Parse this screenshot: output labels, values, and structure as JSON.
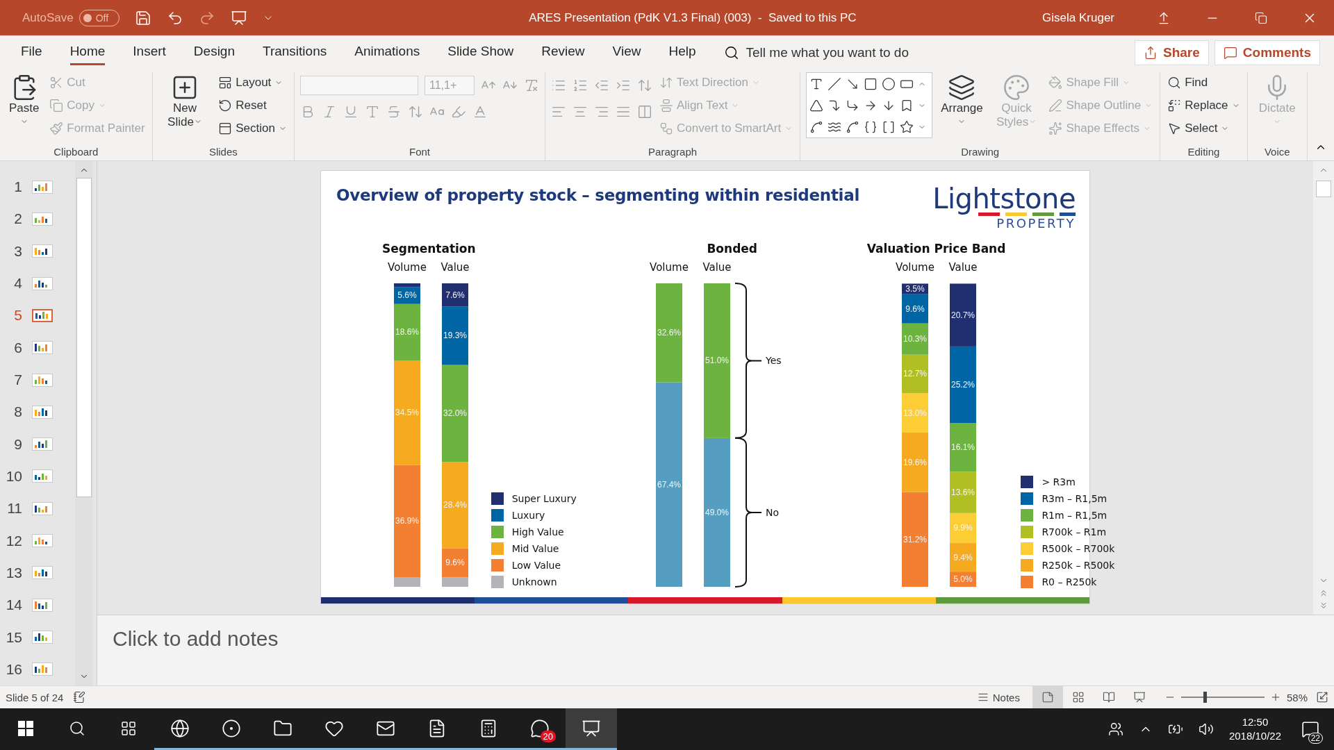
{
  "title_bar": {
    "autosave_label": "AutoSave",
    "autosave": {
      "on": false,
      "label": "Off"
    },
    "title": "ARES Presentation (PdK V1.3 Final) (003)  -  Saved to this PC",
    "user": "Gisela Kruger"
  },
  "tabs": [
    {
      "label": "File",
      "selected": false
    },
    {
      "label": "Home",
      "selected": true
    },
    {
      "label": "Insert",
      "selected": false
    },
    {
      "label": "Design",
      "selected": false
    },
    {
      "label": "Transitions",
      "selected": false
    },
    {
      "label": "Animations",
      "selected": false
    },
    {
      "label": "Slide Show",
      "selected": false
    },
    {
      "label": "Review",
      "selected": false
    },
    {
      "label": "View",
      "selected": false
    },
    {
      "label": "Help",
      "selected": false
    }
  ],
  "search": {
    "placeholder": "Tell me what you want to do"
  },
  "share_button": "Share",
  "comments_button": "Comments",
  "ribbon": {
    "groups": [
      {
        "label": "Clipboard",
        "kind": "plain",
        "items": [
          {
            "kind": "large",
            "label": "Paste",
            "disabled": false,
            "dropdown": true
          },
          {
            "kind": "small",
            "label": "Cut",
            "disabled": true,
            "dropdown": false
          },
          {
            "kind": "small",
            "label": "Copy",
            "disabled": true,
            "dropdown": true
          },
          {
            "kind": "small",
            "label": "Format Painter",
            "disabled": true,
            "dropdown": false
          }
        ]
      },
      {
        "label": "Slides",
        "kind": "plain",
        "items": [
          {
            "kind": "large",
            "label": "New Slide",
            "disabled": false,
            "dropdown": true
          },
          {
            "kind": "small",
            "label": "Layout",
            "disabled": false,
            "dropdown": true
          },
          {
            "kind": "small",
            "label": "Reset",
            "disabled": false,
            "dropdown": false
          },
          {
            "kind": "small",
            "label": "Section",
            "disabled": false,
            "dropdown": true
          }
        ]
      },
      {
        "label": "Font",
        "kind": "font",
        "items": [
          {
            "kind": "field",
            "disabled": true
          },
          {
            "kind": "field",
            "value": "11,1+",
            "disabled": true
          }
        ]
      },
      {
        "label": "Paragraph",
        "kind": "paragraph",
        "items": [
          {
            "kind": "small",
            "label": "Text Direction",
            "disabled": true,
            "dropdown": true
          },
          {
            "kind": "small",
            "label": "Align Text",
            "disabled": true,
            "dropdown": true
          },
          {
            "kind": "small",
            "label": "Convert to SmartArt",
            "disabled": true,
            "dropdown": true
          }
        ]
      },
      {
        "label": "Drawing",
        "kind": "plain",
        "items": [
          {
            "kind": "gallery"
          },
          {
            "kind": "large",
            "label": "Arrange",
            "disabled": false,
            "dropdown": true
          },
          {
            "kind": "large",
            "label": "Quick Styles",
            "disabled": true,
            "dropdown": true
          },
          {
            "kind": "small",
            "label": "Shape Fill",
            "disabled": true,
            "dropdown": true
          },
          {
            "kind": "small",
            "label": "Shape Outline",
            "disabled": true,
            "dropdown": true
          },
          {
            "kind": "small",
            "label": "Shape Effects",
            "disabled": true,
            "dropdown": true
          }
        ]
      },
      {
        "label": "Editing",
        "kind": "plain",
        "items": [
          {
            "kind": "small",
            "label": "Find",
            "disabled": false,
            "dropdown": false
          },
          {
            "kind": "small",
            "label": "Replace",
            "disabled": false,
            "dropdown": true
          },
          {
            "kind": "small",
            "label": "Select",
            "disabled": false,
            "dropdown": true
          }
        ]
      },
      {
        "label": "Voice",
        "kind": "plain",
        "items": [
          {
            "kind": "large",
            "label": "Dictate",
            "disabled": true,
            "dropdown": true
          }
        ]
      }
    ]
  },
  "thumbnails": [
    {
      "number": "1",
      "selected": false
    },
    {
      "number": "2",
      "selected": false
    },
    {
      "number": "3",
      "selected": false
    },
    {
      "number": "4",
      "selected": false
    },
    {
      "number": "5",
      "selected": true
    },
    {
      "number": "6",
      "selected": false
    },
    {
      "number": "7",
      "selected": false
    },
    {
      "number": "8",
      "selected": false
    },
    {
      "number": "9",
      "selected": false
    },
    {
      "number": "10",
      "selected": false
    },
    {
      "number": "11",
      "selected": false
    },
    {
      "number": "12",
      "selected": false
    },
    {
      "number": "13",
      "selected": false
    },
    {
      "number": "14",
      "selected": false
    },
    {
      "number": "15",
      "selected": false
    },
    {
      "number": "16",
      "selected": false
    }
  ],
  "slide": {
    "title": "Overview of property stock – segmenting within residential",
    "logo": {
      "name": "Lightstone",
      "sub": "PROPERTY"
    },
    "charts": [
      {
        "title": "Segmentation",
        "kind": "legend",
        "chart_data": {
          "type": "bar",
          "stacked": true,
          "orientation": "vertical",
          "legend": "right",
          "categories": [
            "Volume",
            "Value"
          ],
          "series": [
            {
              "name": "Unknown",
              "color": "#b3b3b8",
              "values": [
                3.2,
                3.1
              ],
              "value_labels": [
                null,
                null
              ]
            },
            {
              "name": "Low Value",
              "color": "#f37f32",
              "values": [
                36.9,
                9.6
              ],
              "value_labels": [
                "36.9%",
                "9.6%"
              ]
            },
            {
              "name": "Mid Value",
              "color": "#f5aa20",
              "values": [
                34.5,
                28.4
              ],
              "value_labels": [
                "34.5%",
                "28.4%"
              ]
            },
            {
              "name": "High Value",
              "color": "#6db33f",
              "values": [
                18.6,
                32.0
              ],
              "value_labels": [
                "18.6%",
                "32.0%"
              ]
            },
            {
              "name": "Luxury",
              "color": "#0065a4",
              "values": [
                5.6,
                19.3
              ],
              "value_labels": [
                "5.6%",
                "19.3%"
              ]
            },
            {
              "name": "Super Luxury",
              "color": "#1f2f6f",
              "values": [
                1.2,
                7.6
              ],
              "value_labels": [
                null,
                "7.6%"
              ]
            }
          ]
        }
      },
      {
        "title": "Bonded",
        "kind": "brace",
        "chart_data": {
          "type": "bar",
          "stacked": true,
          "orientation": "vertical",
          "categories": [
            "Volume",
            "Value"
          ],
          "series": [
            {
              "name": "No",
              "color": "#569ec1",
              "values": [
                67.4,
                49.0
              ],
              "value_labels": [
                "67.4%",
                "49.0%"
              ]
            },
            {
              "name": "Yes",
              "color": "#6db33f",
              "values": [
                32.6,
                51.0
              ],
              "value_labels": [
                "32.6%",
                "51.0%"
              ]
            }
          ]
        }
      },
      {
        "title": "Valuation Price Band",
        "kind": "legend",
        "chart_data": {
          "type": "bar",
          "stacked": true,
          "orientation": "vertical",
          "legend": "right",
          "categories": [
            "Volume",
            "Value"
          ],
          "series": [
            {
              "name": "R0 – R250k",
              "color": "#f37f32",
              "values": [
                31.2,
                5.0
              ],
              "value_labels": [
                "31.2%",
                "5.0%"
              ]
            },
            {
              "name": "R250k – R500k",
              "color": "#f5aa20",
              "values": [
                19.6,
                9.4
              ],
              "value_labels": [
                "19.6%",
                "9.4%"
              ]
            },
            {
              "name": "R500k – R700k",
              "color": "#fdcd35",
              "values": [
                13.0,
                9.9
              ],
              "value_labels": [
                "13.0%",
                "9.9%"
              ]
            },
            {
              "name": "R700k – R1m",
              "color": "#b2bf22",
              "values": [
                12.7,
                13.6
              ],
              "value_labels": [
                "12.7%",
                "13.6%"
              ]
            },
            {
              "name": "R1m – R1,5m",
              "color": "#6db33f",
              "values": [
                10.3,
                16.1
              ],
              "value_labels": [
                "10.3%",
                "16.1%"
              ]
            },
            {
              "name": "R3m – R1,5m",
              "color": "#0065a4",
              "values": [
                9.6,
                25.2
              ],
              "value_labels": [
                "9.6%",
                "25.2%"
              ]
            },
            {
              "name": "> R3m",
              "color": "#1f2f6f",
              "values": [
                3.5,
                20.7
              ],
              "value_labels": [
                "3.5%",
                "20.7%"
              ]
            }
          ]
        }
      }
    ]
  },
  "notes": {
    "placeholder": "Click to add notes"
  },
  "status_bar": {
    "slide_counter": "Slide 5 of 24",
    "notes_button": "Notes",
    "views": [
      {
        "selected": true
      },
      {
        "selected": false
      },
      {
        "selected": false
      },
      {
        "selected": false
      }
    ],
    "zoom": {
      "level": 0.28,
      "label": "58%"
    }
  },
  "taskbar": {
    "apps": [
      {
        "kind": "browser",
        "running": true,
        "active": false
      },
      {
        "kind": "globe",
        "running": true,
        "active": false
      },
      {
        "kind": "folder",
        "running": true,
        "active": false
      },
      {
        "kind": "heart",
        "running": true,
        "active": false
      },
      {
        "kind": "mail",
        "running": true,
        "active": false
      },
      {
        "kind": "document",
        "running": true,
        "active": false
      },
      {
        "kind": "calculator",
        "running": true,
        "active": false
      },
      {
        "kind": "chat",
        "running": true,
        "active": false,
        "badge": "20"
      },
      {
        "kind": "slides",
        "running": true,
        "active": true
      }
    ],
    "time": "12:50",
    "date": "2018/10/22",
    "notifications": "22"
  }
}
